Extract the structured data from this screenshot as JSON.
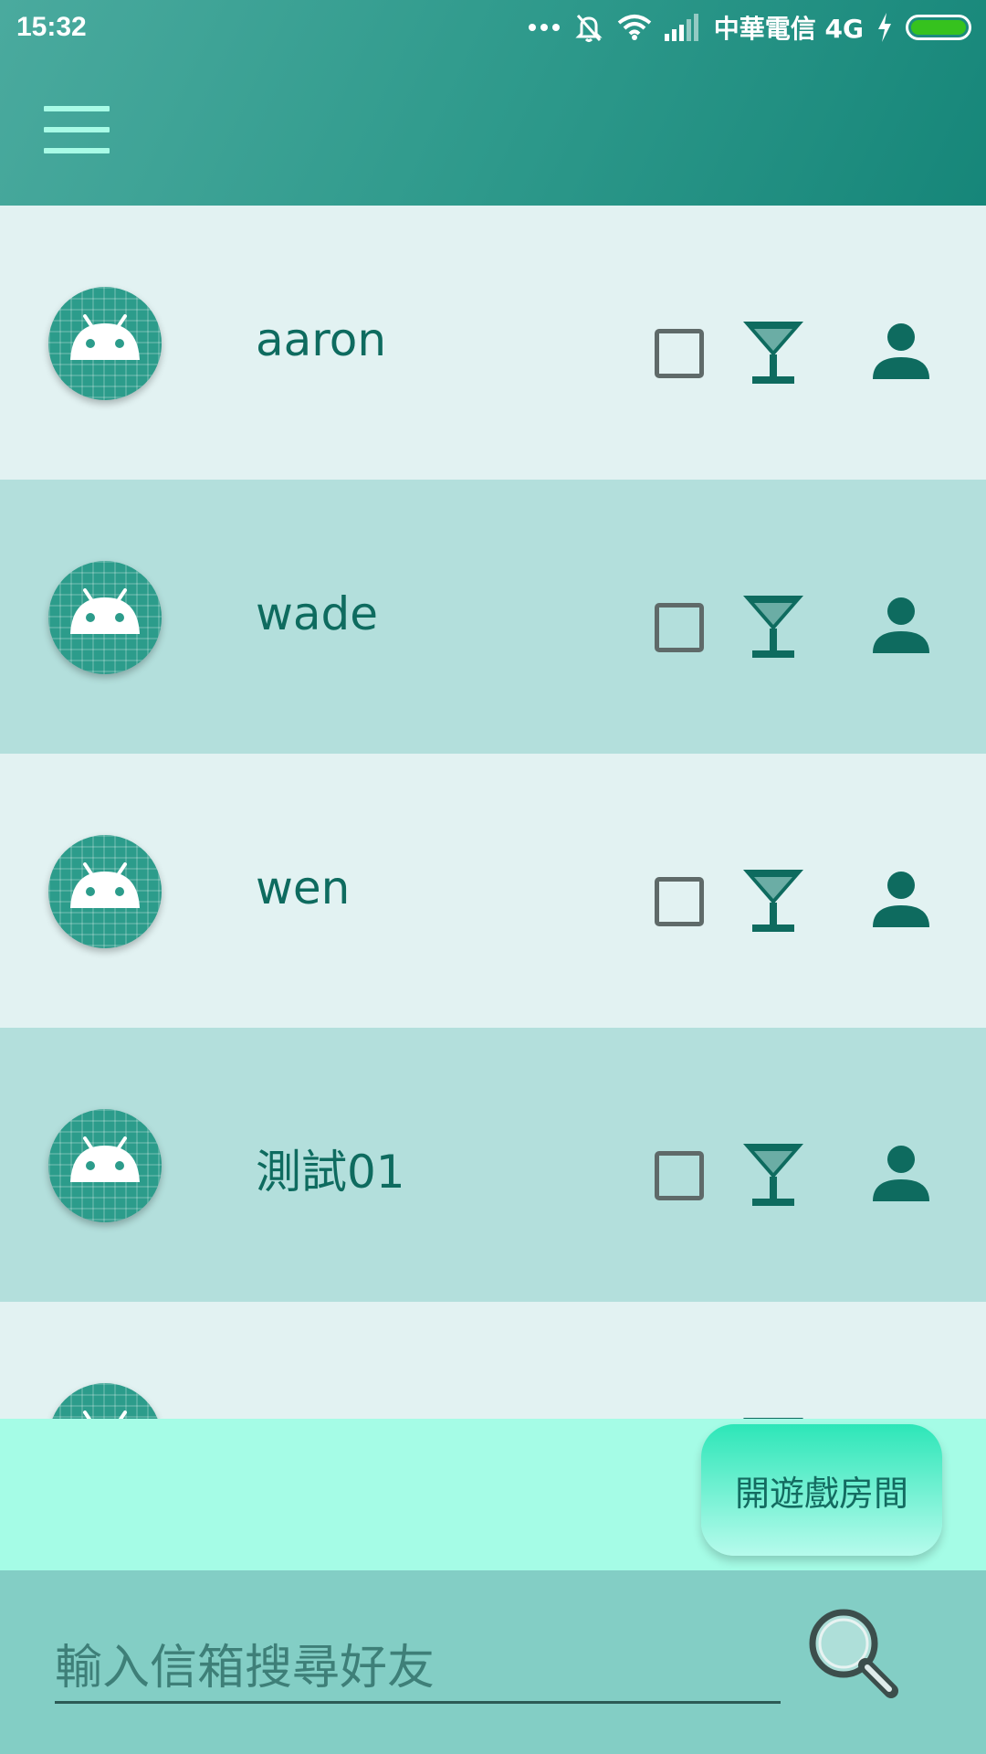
{
  "status_bar": {
    "time": "15:32",
    "carrier": "中華電信 4G",
    "icons": [
      "more-dots-icon",
      "bell-off-icon",
      "wifi-icon",
      "signal-icon",
      "charging-icon",
      "battery-icon"
    ],
    "battery_color": "#36c21e"
  },
  "header": {
    "menu_icon": "hamburger-menu-icon",
    "color_start": "#4aaa9e",
    "color_end": "#168679"
  },
  "friends": [
    {
      "name": "aaron"
    },
    {
      "name": "wade"
    },
    {
      "name": "wen"
    },
    {
      "name": "測試01"
    },
    {
      "name": ""
    }
  ],
  "row_icons": {
    "avatar": "android-avatar-icon",
    "select": "checkbox",
    "invite": "cocktail-icon",
    "profile": "person-icon"
  },
  "action_bar": {
    "open_room_label": "開遊戲房間"
  },
  "search": {
    "placeholder": "輸入信箱搜尋好友",
    "value": "",
    "icon": "magnifier-icon"
  },
  "colors": {
    "accent": "#0e6b5f",
    "row_light": "#e2f2f2",
    "row_dark": "#b3dfdc",
    "action_bar": "#a5fce6",
    "search_bar": "#83cec5"
  }
}
